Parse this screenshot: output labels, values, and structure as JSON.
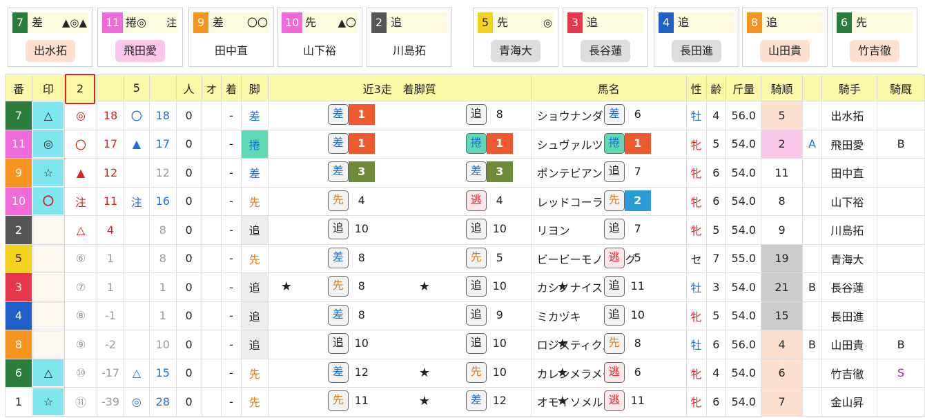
{
  "cards": [
    {
      "num": "7",
      "style": "差",
      "marks": "▲◎▲",
      "jockey": "出水拓",
      "numColor": "#2a7d3a",
      "jkBg": "#fde0d0"
    },
    {
      "num": "11",
      "style": "捲◎",
      "marks": "注",
      "jockey": "飛田愛",
      "numColor": "#f06ad8",
      "jkBg": "#fbc8ec"
    },
    {
      "num": "9",
      "style": "差",
      "marks": "〇〇",
      "jockey": "田中直",
      "numColor": "#f5951f",
      "jkBg": ""
    },
    {
      "num": "10",
      "style": "先",
      "marks": "▲〇",
      "jockey": "山下裕",
      "numColor": "#f06ad8",
      "jkBg": ""
    },
    {
      "num": "2",
      "style": "追",
      "marks": "",
      "jockey": "川島拓",
      "numColor": "#555555",
      "jkBg": ""
    },
    {
      "num": "5",
      "style": "先",
      "marks": "◎",
      "jockey": "青海大",
      "numColor": "#f2d21c",
      "jkBg": "#dddddd",
      "dark": true
    },
    {
      "num": "3",
      "style": "追",
      "marks": "",
      "jockey": "長谷蓮",
      "numColor": "#e8364a",
      "jkBg": "#dddddd"
    },
    {
      "num": "4",
      "style": "追",
      "marks": "",
      "jockey": "長田進",
      "numColor": "#1e5fc8",
      "jkBg": "#dddddd"
    },
    {
      "num": "8",
      "style": "追",
      "marks": "",
      "jockey": "山田貴",
      "numColor": "#f5951f",
      "jkBg": "#fde0d0"
    },
    {
      "num": "6",
      "style": "先",
      "marks": "",
      "jockey": "竹吉徹",
      "numColor": "#2a7d3a",
      "jkBg": "#fde0d0"
    }
  ],
  "headers": {
    "ban": "番",
    "shirushi": "印",
    "col2": "2",
    "col5": "5",
    "hito": "人",
    "o": "オ",
    "chaku": "着",
    "ashi": "脚",
    "recent": "近3走　着脚質",
    "horse": "馬名",
    "sex": "性",
    "age": "齢",
    "weight": "斤量",
    "jrank": "騎順",
    "jockey": "騎手",
    "stable": "騎厩"
  },
  "rows": [
    {
      "num": "7",
      "numBg": "#2a7d3a",
      "mark": "△",
      "hl": true,
      "m2": "◎",
      "v2": "18",
      "m5": "〇",
      "v5": "18",
      "hito": "0",
      "chaku": "-",
      "ashi": "差",
      "ashiCls": "c-sashi",
      "ashiBg": "",
      "recent": [
        {
          "s": "差",
          "p": "1",
          "star": false
        },
        {
          "s": "追",
          "p": "8",
          "star": false
        },
        {
          "s": "差",
          "p": "6",
          "star": false
        }
      ],
      "horse": "ショウナンダダン",
      "sex": "牡",
      "age": "4",
      "weight": "56.0",
      "jr": "5",
      "jrBg": "#fde0d0",
      "x1": "",
      "jockey": "出水拓",
      "x2": ""
    },
    {
      "num": "11",
      "numBg": "#f06ad8",
      "mark": "◎",
      "hl": true,
      "m2": "〇",
      "v2": "17",
      "m5": "▲",
      "v5": "17",
      "hito": "0",
      "chaku": "-",
      "ashi": "捲",
      "ashiCls": "c-makuri",
      "ashiBg": "",
      "recent": [
        {
          "s": "差",
          "p": "1",
          "star": false
        },
        {
          "s": "捲",
          "p": "1",
          "star": false
        },
        {
          "s": "捲",
          "p": "1",
          "star": false
        }
      ],
      "horse": "シュヴァルツナーガ",
      "sex": "牝",
      "age": "5",
      "weight": "54.0",
      "jr": "2",
      "jrBg": "#fbc8ec",
      "x1": "A",
      "jockey": "飛田愛",
      "x2": "B"
    },
    {
      "num": "9",
      "numBg": "#f5951f",
      "mark": "☆",
      "hl": true,
      "m2": "▲",
      "v2": "12",
      "m5": "",
      "v5": "12",
      "hito": "0",
      "chaku": "-",
      "ashi": "差",
      "ashiCls": "c-sashi",
      "ashiBg": "",
      "recent": [
        {
          "s": "差",
          "p": "3",
          "star": false
        },
        {
          "s": "差",
          "p": "3",
          "star": false
        },
        {
          "s": "追",
          "p": "7",
          "star": false
        }
      ],
      "horse": "ポンテビアンカ",
      "sex": "牝",
      "age": "6",
      "weight": "54.0",
      "jr": "11",
      "jrBg": "",
      "x1": "",
      "jockey": "田中直",
      "x2": ""
    },
    {
      "num": "10",
      "numBg": "#f06ad8",
      "mark": "〇",
      "hl": true,
      "m2": "注",
      "v2": "11",
      "m5": "注",
      "v5": "16",
      "hito": "0",
      "chaku": "-",
      "ashi": "先",
      "ashiCls": "c-sen",
      "ashiBg": "",
      "recent": [
        {
          "s": "先",
          "p": "4",
          "star": false
        },
        {
          "s": "逃",
          "p": "4",
          "star": false
        },
        {
          "s": "先",
          "p": "2",
          "star": false
        }
      ],
      "horse": "レッドコーラル",
      "sex": "牝",
      "age": "6",
      "weight": "54.0",
      "jr": "8",
      "jrBg": "",
      "x1": "",
      "jockey": "山下裕",
      "x2": ""
    },
    {
      "num": "2",
      "numBg": "#555555",
      "mark": "",
      "hl": false,
      "m2": "△",
      "v2": "4",
      "m5": "",
      "v5": "8",
      "hito": "0",
      "chaku": "-",
      "ashi": "追",
      "ashiCls": "c-oi",
      "ashiBg": "bg",
      "recent": [
        {
          "s": "追",
          "p": "10",
          "star": false
        },
        {
          "s": "追",
          "p": "10",
          "star": false
        },
        {
          "s": "追",
          "p": "7",
          "star": false
        }
      ],
      "horse": "リヨン",
      "sex": "牝",
      "age": "5",
      "weight": "54.0",
      "jr": "9",
      "jrBg": "",
      "x1": "",
      "jockey": "川島拓",
      "x2": ""
    },
    {
      "num": "5",
      "numBg": "#f2d21c",
      "dark": true,
      "mark": "",
      "hl": false,
      "m2": "⑥",
      "v2": "1",
      "m5": "",
      "v5": "8",
      "hito": "0",
      "chaku": "-",
      "ashi": "先",
      "ashiCls": "c-sen",
      "ashiBg": "",
      "recent": [
        {
          "s": "差",
          "p": "8",
          "star": false
        },
        {
          "s": "先",
          "p": "5",
          "star": false
        },
        {
          "s": "逃",
          "p": "5",
          "star": false
        }
      ],
      "horse": "ビービーモノローグ",
      "sex": "セ",
      "age": "7",
      "weight": "55.0",
      "jr": "19",
      "jrBg": "#cccccc",
      "x1": "",
      "jockey": "青海大",
      "x2": ""
    },
    {
      "num": "3",
      "numBg": "#e8364a",
      "mark": "",
      "hl": false,
      "m2": "⑦",
      "v2": "1",
      "m5": "",
      "v5": "1",
      "hito": "0",
      "chaku": "-",
      "ashi": "追",
      "ashiCls": "c-oi",
      "ashiBg": "bg",
      "recent": [
        {
          "s": "先",
          "p": "8",
          "star": true
        },
        {
          "s": "追",
          "p": "10",
          "star": true
        },
        {
          "s": "追",
          "p": "11",
          "star": true
        }
      ],
      "horse": "カシノナイスガイ",
      "sex": "牡",
      "age": "3",
      "weight": "54.0",
      "jr": "21",
      "jrBg": "#cccccc",
      "x1": "B",
      "jockey": "長谷蓮",
      "x2": ""
    },
    {
      "num": "4",
      "numBg": "#1e5fc8",
      "mark": "",
      "hl": false,
      "m2": "⑧",
      "v2": "-1",
      "m5": "",
      "v5": "1",
      "hito": "0",
      "chaku": "-",
      "ashi": "追",
      "ashiCls": "c-oi",
      "ashiBg": "bg",
      "recent": [
        {
          "s": "差",
          "p": "8",
          "star": false
        },
        {
          "s": "追",
          "p": "9",
          "star": false
        },
        {
          "s": "追",
          "p": "10",
          "star": false
        }
      ],
      "horse": "ミカヅキ",
      "sex": "牝",
      "age": "5",
      "weight": "54.0",
      "jr": "15",
      "jrBg": "#cccccc",
      "x1": "",
      "jockey": "長田進",
      "x2": ""
    },
    {
      "num": "8",
      "numBg": "#f5951f",
      "mark": "",
      "hl": false,
      "m2": "⑨",
      "v2": "-2",
      "m5": "",
      "v5": "10",
      "hito": "0",
      "chaku": "-",
      "ashi": "追",
      "ashiCls": "c-oi",
      "ashiBg": "bg",
      "recent": [
        {
          "s": "追",
          "p": "10",
          "star": false
        },
        {
          "s": "追",
          "p": "10",
          "star": false
        },
        {
          "s": "先",
          "p": "8",
          "star": true
        }
      ],
      "horse": "ロジスティクス",
      "sex": "牡",
      "age": "6",
      "weight": "56.0",
      "jr": "4",
      "jrBg": "#fde0d0",
      "x1": "B",
      "jockey": "山田貴",
      "x2": "B"
    },
    {
      "num": "6",
      "numBg": "#2a7d3a",
      "mark": "△",
      "hl": true,
      "m2": "⑩",
      "v2": "-17",
      "m5": "△",
      "v5": "15",
      "hito": "0",
      "chaku": "-",
      "ashi": "先",
      "ashiCls": "c-sen",
      "ashiBg": "",
      "recent": [
        {
          "s": "差",
          "p": "12",
          "star": false
        },
        {
          "s": "先",
          "p": "10",
          "star": true
        },
        {
          "s": "逃",
          "p": "6",
          "star": true
        }
      ],
      "horse": "カレンメラメーラ",
      "sex": "牝",
      "age": "4",
      "weight": "54.0",
      "jr": "6",
      "jrBg": "#fde0d0",
      "x1": "",
      "jockey": "竹吉徹",
      "x2": "S"
    },
    {
      "num": "1",
      "numBg": "#ffffff",
      "dark": true,
      "mark": "☆",
      "hl": true,
      "m2": "⑪",
      "v2": "-39",
      "m5": "◎",
      "v5": "28",
      "hito": "0",
      "chaku": "-",
      "ashi": "先",
      "ashiCls": "c-sen",
      "ashiBg": "",
      "recent": [
        {
          "s": "先",
          "p": "11",
          "star": false
        },
        {
          "s": "差",
          "p": "12",
          "star": true
        },
        {
          "s": "逃",
          "p": "11",
          "star": true
        }
      ],
      "horse": "オモイソメル",
      "sex": "牝",
      "age": "6",
      "weight": "54.0",
      "jr": "7",
      "jrBg": "#fde0d0",
      "x1": "",
      "jockey": "金山昇",
      "x2": ""
    }
  ]
}
